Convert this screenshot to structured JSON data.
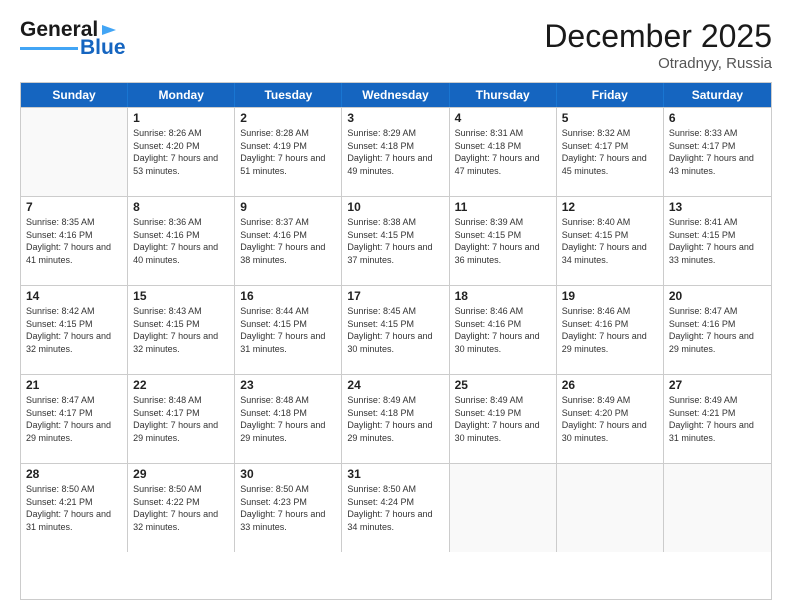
{
  "header": {
    "logo_line1": "General",
    "logo_line2": "Blue",
    "title": "December 2025",
    "subtitle": "Otradnyy, Russia"
  },
  "weekdays": [
    "Sunday",
    "Monday",
    "Tuesday",
    "Wednesday",
    "Thursday",
    "Friday",
    "Saturday"
  ],
  "weeks": [
    [
      {
        "day": "",
        "sunrise": "",
        "sunset": "",
        "daylight": ""
      },
      {
        "day": "1",
        "sunrise": "Sunrise: 8:26 AM",
        "sunset": "Sunset: 4:20 PM",
        "daylight": "Daylight: 7 hours and 53 minutes."
      },
      {
        "day": "2",
        "sunrise": "Sunrise: 8:28 AM",
        "sunset": "Sunset: 4:19 PM",
        "daylight": "Daylight: 7 hours and 51 minutes."
      },
      {
        "day": "3",
        "sunrise": "Sunrise: 8:29 AM",
        "sunset": "Sunset: 4:18 PM",
        "daylight": "Daylight: 7 hours and 49 minutes."
      },
      {
        "day": "4",
        "sunrise": "Sunrise: 8:31 AM",
        "sunset": "Sunset: 4:18 PM",
        "daylight": "Daylight: 7 hours and 47 minutes."
      },
      {
        "day": "5",
        "sunrise": "Sunrise: 8:32 AM",
        "sunset": "Sunset: 4:17 PM",
        "daylight": "Daylight: 7 hours and 45 minutes."
      },
      {
        "day": "6",
        "sunrise": "Sunrise: 8:33 AM",
        "sunset": "Sunset: 4:17 PM",
        "daylight": "Daylight: 7 hours and 43 minutes."
      }
    ],
    [
      {
        "day": "7",
        "sunrise": "Sunrise: 8:35 AM",
        "sunset": "Sunset: 4:16 PM",
        "daylight": "Daylight: 7 hours and 41 minutes."
      },
      {
        "day": "8",
        "sunrise": "Sunrise: 8:36 AM",
        "sunset": "Sunset: 4:16 PM",
        "daylight": "Daylight: 7 hours and 40 minutes."
      },
      {
        "day": "9",
        "sunrise": "Sunrise: 8:37 AM",
        "sunset": "Sunset: 4:16 PM",
        "daylight": "Daylight: 7 hours and 38 minutes."
      },
      {
        "day": "10",
        "sunrise": "Sunrise: 8:38 AM",
        "sunset": "Sunset: 4:15 PM",
        "daylight": "Daylight: 7 hours and 37 minutes."
      },
      {
        "day": "11",
        "sunrise": "Sunrise: 8:39 AM",
        "sunset": "Sunset: 4:15 PM",
        "daylight": "Daylight: 7 hours and 36 minutes."
      },
      {
        "day": "12",
        "sunrise": "Sunrise: 8:40 AM",
        "sunset": "Sunset: 4:15 PM",
        "daylight": "Daylight: 7 hours and 34 minutes."
      },
      {
        "day": "13",
        "sunrise": "Sunrise: 8:41 AM",
        "sunset": "Sunset: 4:15 PM",
        "daylight": "Daylight: 7 hours and 33 minutes."
      }
    ],
    [
      {
        "day": "14",
        "sunrise": "Sunrise: 8:42 AM",
        "sunset": "Sunset: 4:15 PM",
        "daylight": "Daylight: 7 hours and 32 minutes."
      },
      {
        "day": "15",
        "sunrise": "Sunrise: 8:43 AM",
        "sunset": "Sunset: 4:15 PM",
        "daylight": "Daylight: 7 hours and 32 minutes."
      },
      {
        "day": "16",
        "sunrise": "Sunrise: 8:44 AM",
        "sunset": "Sunset: 4:15 PM",
        "daylight": "Daylight: 7 hours and 31 minutes."
      },
      {
        "day": "17",
        "sunrise": "Sunrise: 8:45 AM",
        "sunset": "Sunset: 4:15 PM",
        "daylight": "Daylight: 7 hours and 30 minutes."
      },
      {
        "day": "18",
        "sunrise": "Sunrise: 8:46 AM",
        "sunset": "Sunset: 4:16 PM",
        "daylight": "Daylight: 7 hours and 30 minutes."
      },
      {
        "day": "19",
        "sunrise": "Sunrise: 8:46 AM",
        "sunset": "Sunset: 4:16 PM",
        "daylight": "Daylight: 7 hours and 29 minutes."
      },
      {
        "day": "20",
        "sunrise": "Sunrise: 8:47 AM",
        "sunset": "Sunset: 4:16 PM",
        "daylight": "Daylight: 7 hours and 29 minutes."
      }
    ],
    [
      {
        "day": "21",
        "sunrise": "Sunrise: 8:47 AM",
        "sunset": "Sunset: 4:17 PM",
        "daylight": "Daylight: 7 hours and 29 minutes."
      },
      {
        "day": "22",
        "sunrise": "Sunrise: 8:48 AM",
        "sunset": "Sunset: 4:17 PM",
        "daylight": "Daylight: 7 hours and 29 minutes."
      },
      {
        "day": "23",
        "sunrise": "Sunrise: 8:48 AM",
        "sunset": "Sunset: 4:18 PM",
        "daylight": "Daylight: 7 hours and 29 minutes."
      },
      {
        "day": "24",
        "sunrise": "Sunrise: 8:49 AM",
        "sunset": "Sunset: 4:18 PM",
        "daylight": "Daylight: 7 hours and 29 minutes."
      },
      {
        "day": "25",
        "sunrise": "Sunrise: 8:49 AM",
        "sunset": "Sunset: 4:19 PM",
        "daylight": "Daylight: 7 hours and 30 minutes."
      },
      {
        "day": "26",
        "sunrise": "Sunrise: 8:49 AM",
        "sunset": "Sunset: 4:20 PM",
        "daylight": "Daylight: 7 hours and 30 minutes."
      },
      {
        "day": "27",
        "sunrise": "Sunrise: 8:49 AM",
        "sunset": "Sunset: 4:21 PM",
        "daylight": "Daylight: 7 hours and 31 minutes."
      }
    ],
    [
      {
        "day": "28",
        "sunrise": "Sunrise: 8:50 AM",
        "sunset": "Sunset: 4:21 PM",
        "daylight": "Daylight: 7 hours and 31 minutes."
      },
      {
        "day": "29",
        "sunrise": "Sunrise: 8:50 AM",
        "sunset": "Sunset: 4:22 PM",
        "daylight": "Daylight: 7 hours and 32 minutes."
      },
      {
        "day": "30",
        "sunrise": "Sunrise: 8:50 AM",
        "sunset": "Sunset: 4:23 PM",
        "daylight": "Daylight: 7 hours and 33 minutes."
      },
      {
        "day": "31",
        "sunrise": "Sunrise: 8:50 AM",
        "sunset": "Sunset: 4:24 PM",
        "daylight": "Daylight: 7 hours and 34 minutes."
      },
      {
        "day": "",
        "sunrise": "",
        "sunset": "",
        "daylight": ""
      },
      {
        "day": "",
        "sunrise": "",
        "sunset": "",
        "daylight": ""
      },
      {
        "day": "",
        "sunrise": "",
        "sunset": "",
        "daylight": ""
      }
    ]
  ]
}
